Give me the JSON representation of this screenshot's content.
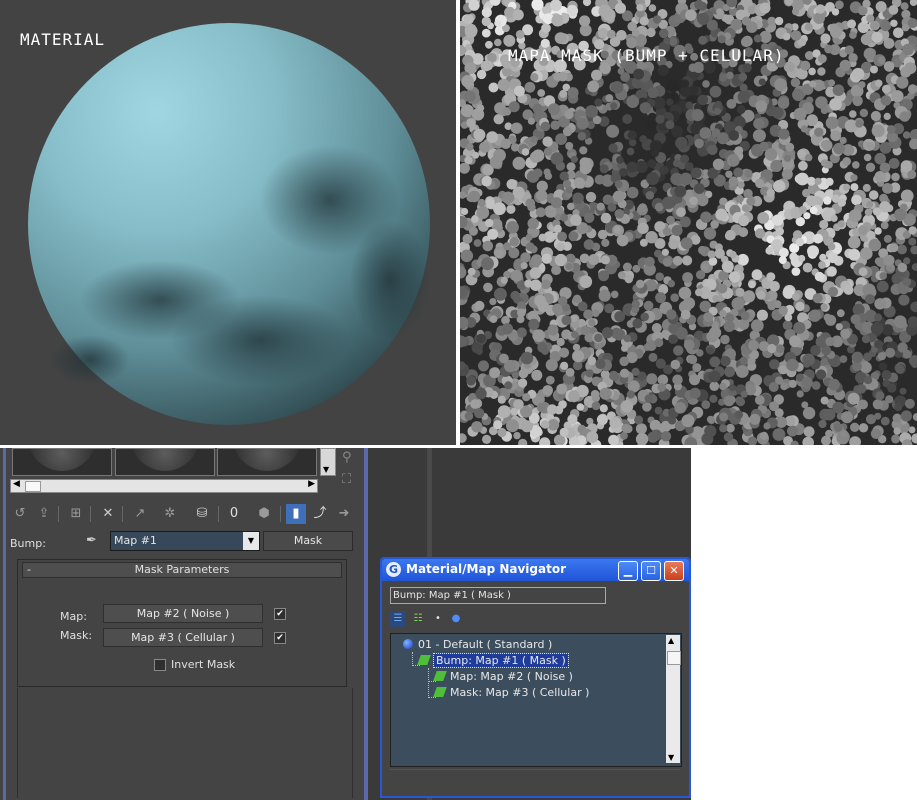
{
  "panels": {
    "material_label": "MATERIAL",
    "mask_label": "MAPA MASK (BUMP + CELULAR)",
    "sphere_color": "#7fb1bb",
    "mask_base_color": "#6e6e6e"
  },
  "editor": {
    "toolbar_icons": [
      "get-material-icon",
      "put-to-scene-icon",
      "assign-icon",
      "reset-icon",
      "copy-icon",
      "unique-icon",
      "put-library-icon",
      "material-id-icon",
      "show-in-viewport-icon",
      "show-end-result-icon",
      "go-parent-icon",
      "go-sibling-icon"
    ],
    "bump_label": "Bump:",
    "map_name": "Map #1",
    "map_type": "Mask",
    "rollout": {
      "toggle": "-",
      "title": "Mask Parameters"
    },
    "map_label": "Map:",
    "map_value": "Map #2  ( Noise )",
    "mask_label": "Mask:",
    "mask_value": "Map #3  ( Cellular )",
    "invert_label": "Invert Mask",
    "map_checked": true,
    "mask_checked": true,
    "invert_checked": false
  },
  "navigator": {
    "title": "Material/Map Navigator",
    "path": "Bump: Map #1  ( Mask )",
    "tree": [
      {
        "label": "01 - Default  ( Standard )",
        "icon": "material-sphere-icon",
        "level": 0
      },
      {
        "label": "Bump: Map #1  ( Mask )",
        "icon": "map-icon",
        "level": 1,
        "selected": true
      },
      {
        "label": "Map: Map #2  ( Noise )",
        "icon": "map-icon",
        "level": 2
      },
      {
        "label": "Mask: Map #3  ( Cellular )",
        "icon": "map-icon",
        "level": 2
      }
    ],
    "accent_color": "#2758d8"
  }
}
